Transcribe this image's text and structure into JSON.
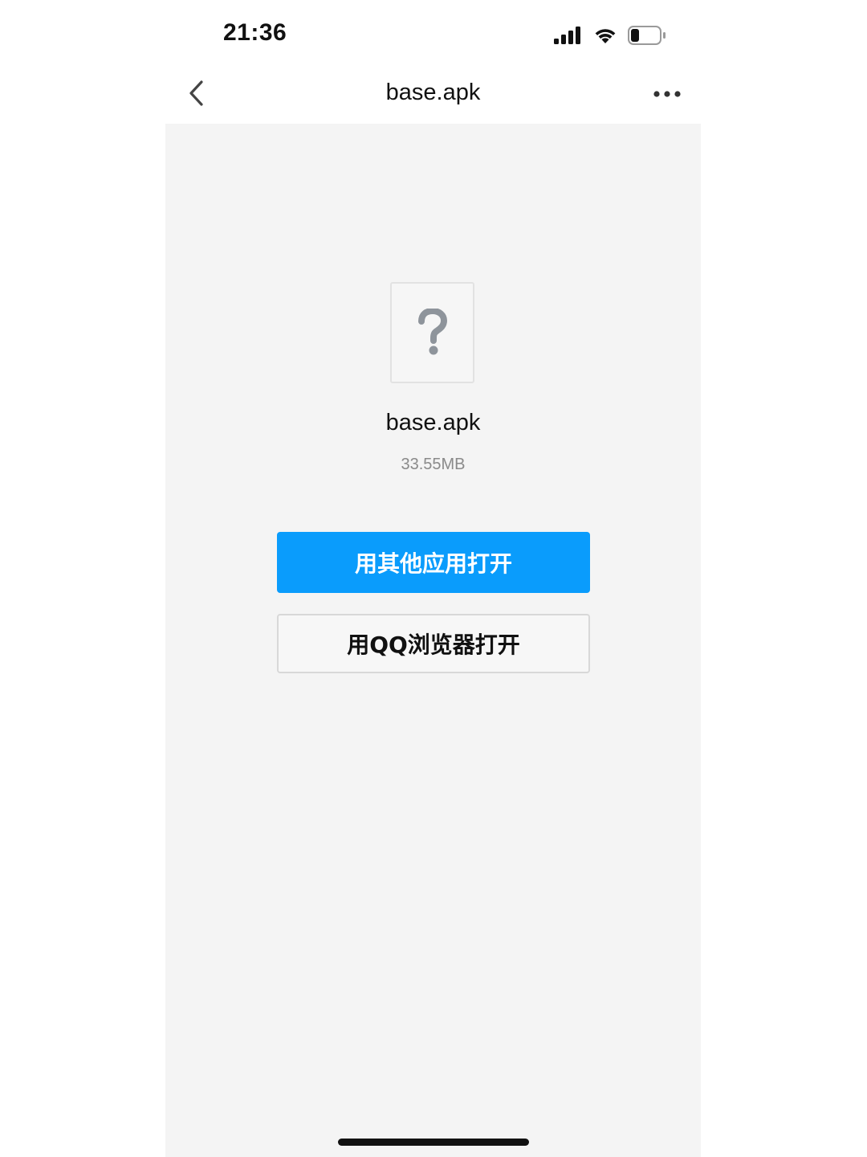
{
  "status_bar": {
    "time": "21:36",
    "icons": [
      "cellular-signal-icon",
      "wifi-icon",
      "battery-icon"
    ],
    "battery_level": 0.3
  },
  "nav": {
    "title": "base.apk",
    "back_icon": "chevron-left-icon",
    "more_icon": "more-dots-icon"
  },
  "file": {
    "icon": "unknown-file-icon",
    "icon_glyph": "?",
    "name": "base.apk",
    "size": "33.55MB"
  },
  "actions": {
    "open_other_label": "用其他应用打开",
    "open_qq_label": "用QQ浏览器打开"
  },
  "colors": {
    "primary_button": "#0a9cfc",
    "content_background": "#f4f4f4"
  }
}
